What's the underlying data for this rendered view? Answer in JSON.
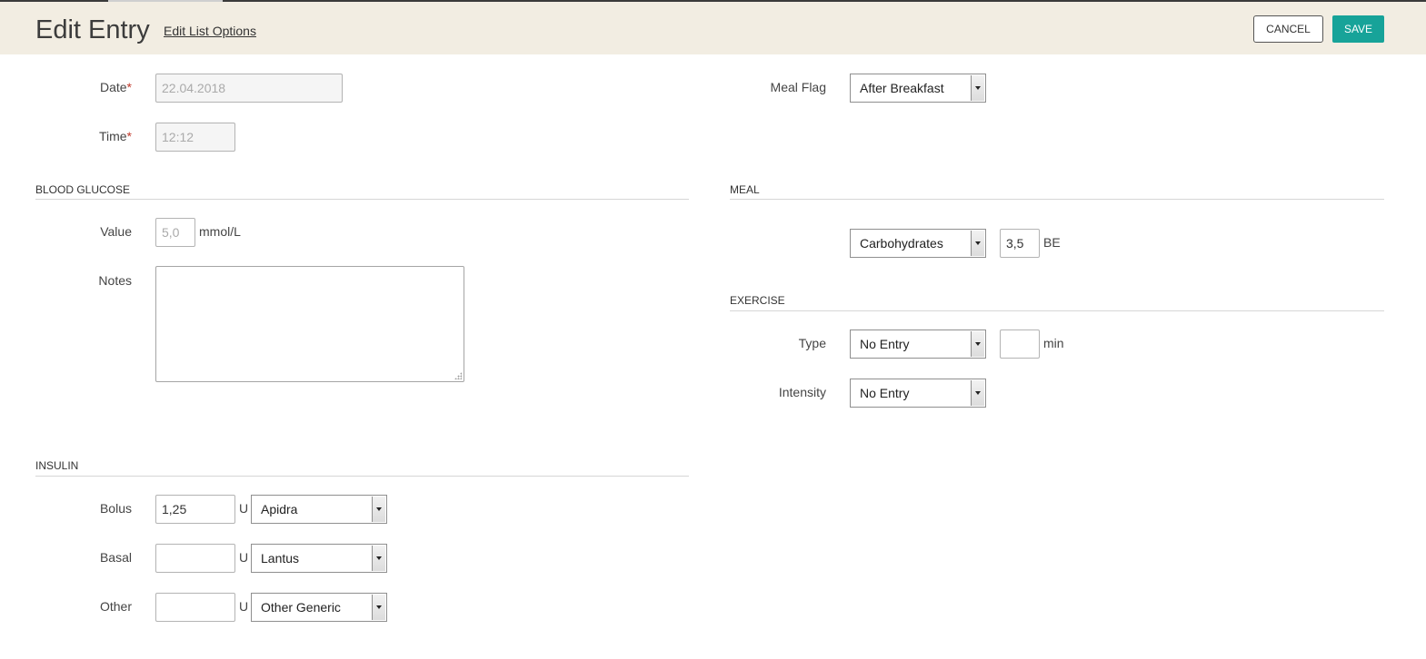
{
  "header": {
    "title": "Edit Entry",
    "edit_list_options": "Edit List Options",
    "cancel": "CANCEL",
    "save": "SAVE"
  },
  "fields": {
    "date": {
      "label": "Date",
      "required_mark": "*",
      "value": "22.04.2018"
    },
    "time": {
      "label": "Time",
      "required_mark": "*",
      "value": "12:12"
    },
    "meal_flag": {
      "label": "Meal Flag",
      "value": "After Breakfast"
    }
  },
  "blood_glucose": {
    "heading": "BLOOD GLUCOSE",
    "value_label": "Value",
    "value_placeholder": "5,0",
    "unit": "mmol/L",
    "notes_label": "Notes",
    "notes_value": ""
  },
  "meal": {
    "heading": "MEAL",
    "type": "Carbohydrates",
    "amount": "3,5",
    "unit": "BE"
  },
  "exercise": {
    "heading": "EXERCISE",
    "type_label": "Type",
    "type_value": "No Entry",
    "duration_value": "",
    "duration_unit": "min",
    "intensity_label": "Intensity",
    "intensity_value": "No Entry"
  },
  "insulin": {
    "heading": "INSULIN",
    "unit": "U",
    "rows": [
      {
        "label": "Bolus",
        "amount": "1,25",
        "type": "Apidra"
      },
      {
        "label": "Basal",
        "amount": "",
        "type": "Lantus"
      },
      {
        "label": "Other",
        "amount": "",
        "type": "Other Generic"
      }
    ]
  },
  "colors": {
    "header_bg": "#f2ede2",
    "save_bg": "#17a399",
    "required": "#c0392b"
  }
}
